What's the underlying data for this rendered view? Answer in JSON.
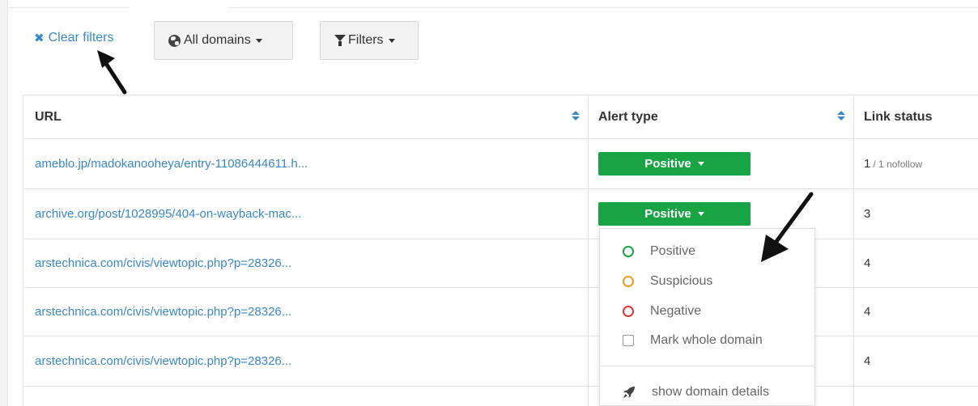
{
  "filters": {
    "clear_label": "Clear filters",
    "domains_label": "All domains",
    "filters_label": "Filters"
  },
  "table": {
    "columns": [
      "URL",
      "Alert type",
      "Link status"
    ],
    "rows": [
      {
        "url": "ameblo.jp/madokanooheya/entry-11086444611.h...",
        "alert": "Positive",
        "link_count": "1",
        "link_note": "/ 1 nofollow"
      },
      {
        "url": "archive.org/post/1028995/404-on-wayback-mac...",
        "alert": "Positive",
        "link_count": "3",
        "link_note": ""
      },
      {
        "url": "arstechnica.com/civis/viewtopic.php?p=28326...",
        "alert": "",
        "link_count": "4",
        "link_note": ""
      },
      {
        "url": "arstechnica.com/civis/viewtopic.php?p=28326...",
        "alert": "",
        "link_count": "4",
        "link_note": ""
      },
      {
        "url": "arstechnica.com/civis/viewtopic.php?p=28326...",
        "alert": "",
        "link_count": "4",
        "link_note": ""
      }
    ]
  },
  "dropdown": {
    "positive": "Positive",
    "suspicious": "Suspicious",
    "negative": "Negative",
    "mark_domain": "Mark whole domain",
    "domain_details": "show domain details"
  },
  "icons": {
    "clear": "times-icon",
    "domains": "globe-icon",
    "filters": "funnel-icon",
    "details": "rocket-icon"
  },
  "colors": {
    "link": "#3a87c8",
    "positive": "#18a345",
    "suspicious": "#e89b1f",
    "negative": "#d9372e"
  }
}
